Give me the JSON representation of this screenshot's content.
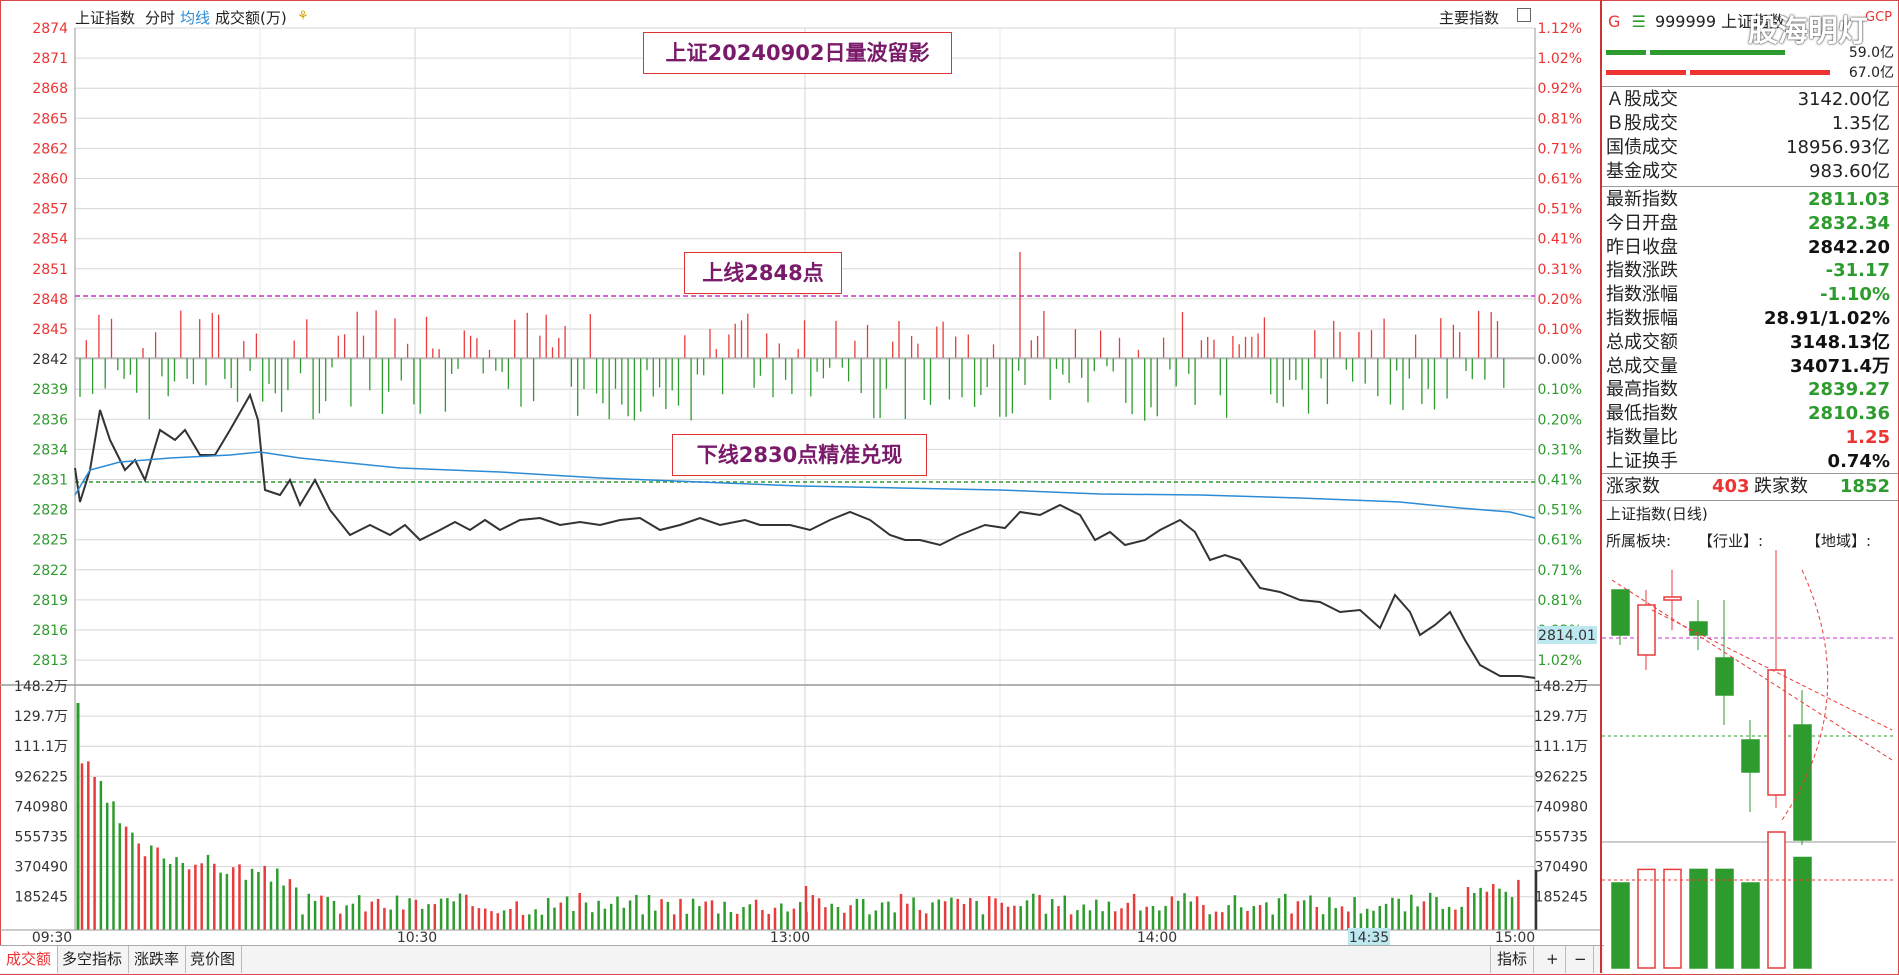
{
  "topbar": {
    "title": "上证指数",
    "period": "分时",
    "avg_label": "均线",
    "vol_label": "成交额(万)",
    "main_index_label": "主要指数"
  },
  "annotations": {
    "title": "上证20240902日量波留影",
    "upper": "上线2848点",
    "lower": "下线2830点精准兑现"
  },
  "price_axis": {
    "left": [
      "2874",
      "2871",
      "2868",
      "2865",
      "2862",
      "2860",
      "2857",
      "2854",
      "2851",
      "2848",
      "2845",
      "2842",
      "2839",
      "2836",
      "2834",
      "2831",
      "2828",
      "2825",
      "2822",
      "2819",
      "2816",
      "2813"
    ],
    "right": [
      "1.12%",
      "1.02%",
      "0.92%",
      "0.81%",
      "0.71%",
      "0.61%",
      "0.51%",
      "0.41%",
      "0.31%",
      "0.20%",
      "0.10%",
      "0.00%",
      "0.10%",
      "0.20%",
      "0.31%",
      "0.41%",
      "0.51%",
      "0.61%",
      "0.71%",
      "0.81%",
      "0.92%",
      "1.02%"
    ],
    "current_tag": "2814.01"
  },
  "volume_axis": {
    "labels": [
      "148.2万",
      "129.7万",
      "111.1万",
      "926225",
      "740980",
      "555735",
      "370490",
      "185245"
    ]
  },
  "time_axis": {
    "labels": [
      "09:30",
      "10:30",
      "13:00",
      "14:00",
      "15:00"
    ],
    "cursor": "14:35"
  },
  "bottom_tabs": {
    "items": [
      "成交额",
      "多空指标",
      "涨跌率",
      "竞价图"
    ],
    "indicator": "指标",
    "plus": "+",
    "minus": "−"
  },
  "colors": {
    "up": "#e83b3b",
    "down": "#2e9b2e",
    "price_line": "#333333",
    "avg_line": "#2b8bd6",
    "pink_dashed": "#cc33cc",
    "green_dashed": "#2e9b2e"
  },
  "right_panel": {
    "header": {
      "g": "G",
      "code": "999999",
      "name": "上证指数",
      "badge": "GCP",
      "watermark": "股海明灯",
      "v1": "59.0亿",
      "v2": "67.0亿"
    },
    "turnover": [
      {
        "label": "Ａ股成交",
        "value": "3142.00亿"
      },
      {
        "label": "Ｂ股成交",
        "value": "1.35亿"
      },
      {
        "label": "国债成交",
        "value": "18956.93亿"
      },
      {
        "label": "基金成交",
        "value": "983.60亿"
      }
    ],
    "stats": [
      {
        "label": "最新指数",
        "value": "2811.03",
        "color": "green"
      },
      {
        "label": "今日开盘",
        "value": "2832.34",
        "color": "green"
      },
      {
        "label": "昨日收盘",
        "value": "2842.20",
        "color": "black"
      },
      {
        "label": "指数涨跌",
        "value": "-31.17",
        "color": "green"
      },
      {
        "label": "指数涨幅",
        "value": "-1.10%",
        "color": "green"
      },
      {
        "label": "指数振幅",
        "value": "28.91/1.02%",
        "color": "black"
      },
      {
        "label": "总成交额",
        "value": "3148.13亿",
        "color": "black"
      },
      {
        "label": "总成交量",
        "value": "34071.4万",
        "color": "black"
      },
      {
        "label": "最高指数",
        "value": "2839.27",
        "color": "green"
      },
      {
        "label": "最低指数",
        "value": "2810.36",
        "color": "green"
      },
      {
        "label": "指数量比",
        "value": "1.25",
        "color": "red"
      },
      {
        "label": "上证换手",
        "value": "0.74%",
        "color": "black"
      }
    ],
    "breadth": {
      "up_label": "涨家数",
      "up": "403",
      "down_label": "跌家数",
      "down": "1852"
    },
    "daily": {
      "title": "上证指数(日线)",
      "sector_label": "所属板块:",
      "industry": "【行业】:",
      "region": "【地域】:"
    }
  }
}
